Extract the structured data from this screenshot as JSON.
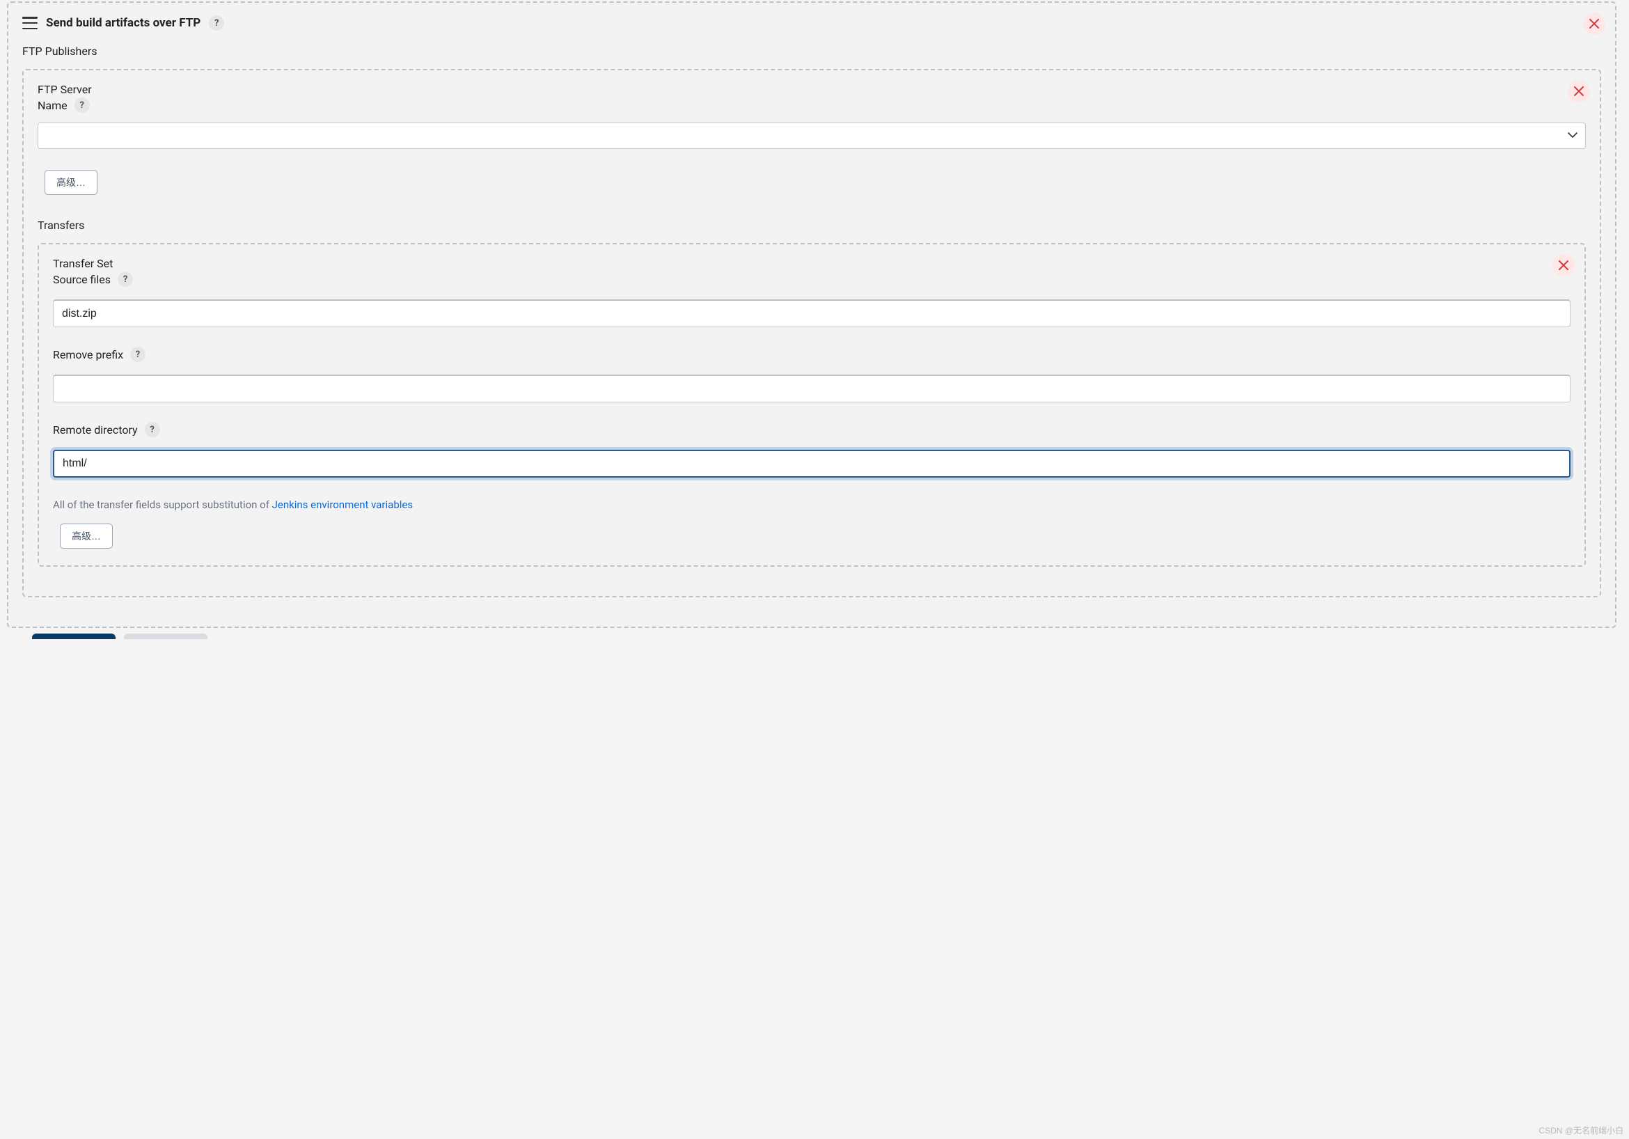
{
  "panel": {
    "title": "Send build artifacts over FTP",
    "publishers_label": "FTP Publishers",
    "help_glyph": "?"
  },
  "server": {
    "group_title": "FTP Server",
    "name_label": "Name",
    "selected": "",
    "advanced_button": "高级…"
  },
  "transfers": {
    "section_label": "Transfers",
    "set_title": "Transfer Set",
    "source_files": {
      "label": "Source files",
      "value": "dist.zip"
    },
    "remove_prefix": {
      "label": "Remove prefix",
      "value": ""
    },
    "remote_directory": {
      "label": "Remote directory",
      "value": "html/"
    },
    "help_prefix": "All of the transfer fields support substitution of ",
    "help_link": "Jenkins environment variables",
    "advanced_button": "高级…"
  },
  "watermark": "CSDN @无名前端小白"
}
